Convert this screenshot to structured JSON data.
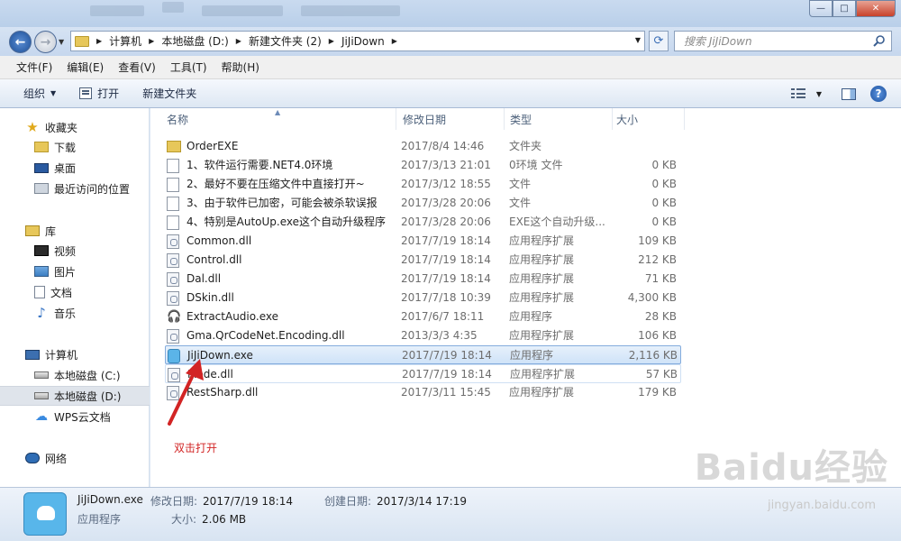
{
  "window": {
    "controls": {
      "minimize": "—",
      "maximize": "□",
      "close": "✕"
    }
  },
  "address": {
    "crumbs": [
      "计算机",
      "本地磁盘 (D:)",
      "新建文件夹 (2)",
      "JiJiDown"
    ],
    "search_placeholder": "搜索 JiJiDown"
  },
  "menu": [
    "文件(F)",
    "编辑(E)",
    "查看(V)",
    "工具(T)",
    "帮助(H)"
  ],
  "toolbar": {
    "organize": "组织",
    "open": "打开",
    "new_folder": "新建文件夹",
    "help": "?"
  },
  "sidebar": {
    "favorites": {
      "label": "收藏夹",
      "items": [
        "下载",
        "桌面",
        "最近访问的位置"
      ]
    },
    "libraries": {
      "label": "库",
      "items": [
        "视频",
        "图片",
        "文档",
        "音乐"
      ]
    },
    "computer": {
      "label": "计算机",
      "items": [
        "本地磁盘 (C:)",
        "本地磁盘 (D:)",
        "WPS云文档"
      ]
    },
    "network": {
      "label": "网络"
    }
  },
  "columns": {
    "name": "名称",
    "date": "修改日期",
    "type": "类型",
    "size": "大小"
  },
  "files": [
    {
      "name": "OrderEXE",
      "date": "2017/8/4 14:46",
      "type": "文件夹",
      "size": "",
      "icon": "folder-icon"
    },
    {
      "name": "1、软件运行需要.NET4.0环境",
      "date": "2017/3/13 21:01",
      "type": "0环境 文件",
      "size": "0 KB",
      "icon": "text-file-icon"
    },
    {
      "name": "2、最好不要在压缩文件中直接打开~",
      "date": "2017/3/12 18:55",
      "type": "文件",
      "size": "0 KB",
      "icon": "text-file-icon"
    },
    {
      "name": "3、由于软件已加密，可能会被杀软误报",
      "date": "2017/3/28 20:06",
      "type": "文件",
      "size": "0 KB",
      "icon": "text-file-icon"
    },
    {
      "name": "4、特别是AutoUp.exe这个自动升级程序",
      "date": "2017/3/28 20:06",
      "type": "EXE这个自动升级...",
      "size": "0 KB",
      "icon": "text-file-icon"
    },
    {
      "name": "Common.dll",
      "date": "2017/7/19 18:14",
      "type": "应用程序扩展",
      "size": "109 KB",
      "icon": "dll-icon"
    },
    {
      "name": "Control.dll",
      "date": "2017/7/19 18:14",
      "type": "应用程序扩展",
      "size": "212 KB",
      "icon": "dll-icon"
    },
    {
      "name": "Dal.dll",
      "date": "2017/7/19 18:14",
      "type": "应用程序扩展",
      "size": "71 KB",
      "icon": "dll-icon"
    },
    {
      "name": "DSkin.dll",
      "date": "2017/7/18 10:39",
      "type": "应用程序扩展",
      "size": "4,300 KB",
      "icon": "dll-icon"
    },
    {
      "name": "ExtractAudio.exe",
      "date": "2017/6/7 18:11",
      "type": "应用程序",
      "size": "28 KB",
      "icon": "headphones-icon"
    },
    {
      "name": "Gma.QrCodeNet.Encoding.dll",
      "date": "2013/3/3 4:35",
      "type": "应用程序扩展",
      "size": "106 KB",
      "icon": "dll-icon"
    },
    {
      "name": "JiJiDown.exe",
      "date": "2017/7/19 18:14",
      "type": "应用程序",
      "size": "2,116 KB",
      "icon": "app-icon"
    },
    {
      "name": "Mode.dll",
      "date": "2017/7/19 18:14",
      "type": "应用程序扩展",
      "size": "57 KB",
      "icon": "dll-icon"
    },
    {
      "name": "RestSharp.dll",
      "date": "2017/3/11 15:45",
      "type": "应用程序扩展",
      "size": "179 KB",
      "icon": "dll-icon"
    }
  ],
  "annotation": "双击打开",
  "details": {
    "filename": "JiJiDown.exe",
    "type": "应用程序",
    "modified_label": "修改日期:",
    "modified": "2017/7/19 18:14",
    "created_label": "创建日期:",
    "created": "2017/3/14 17:19",
    "size_label": "大小:",
    "size": "2.06 MB"
  },
  "watermark": {
    "main": "Baidu经验",
    "sub": "jingyan.baidu.com"
  },
  "colors": {
    "selection": "#cfe3f8",
    "annotation": "#d22424",
    "accent": "#3a6db5"
  }
}
